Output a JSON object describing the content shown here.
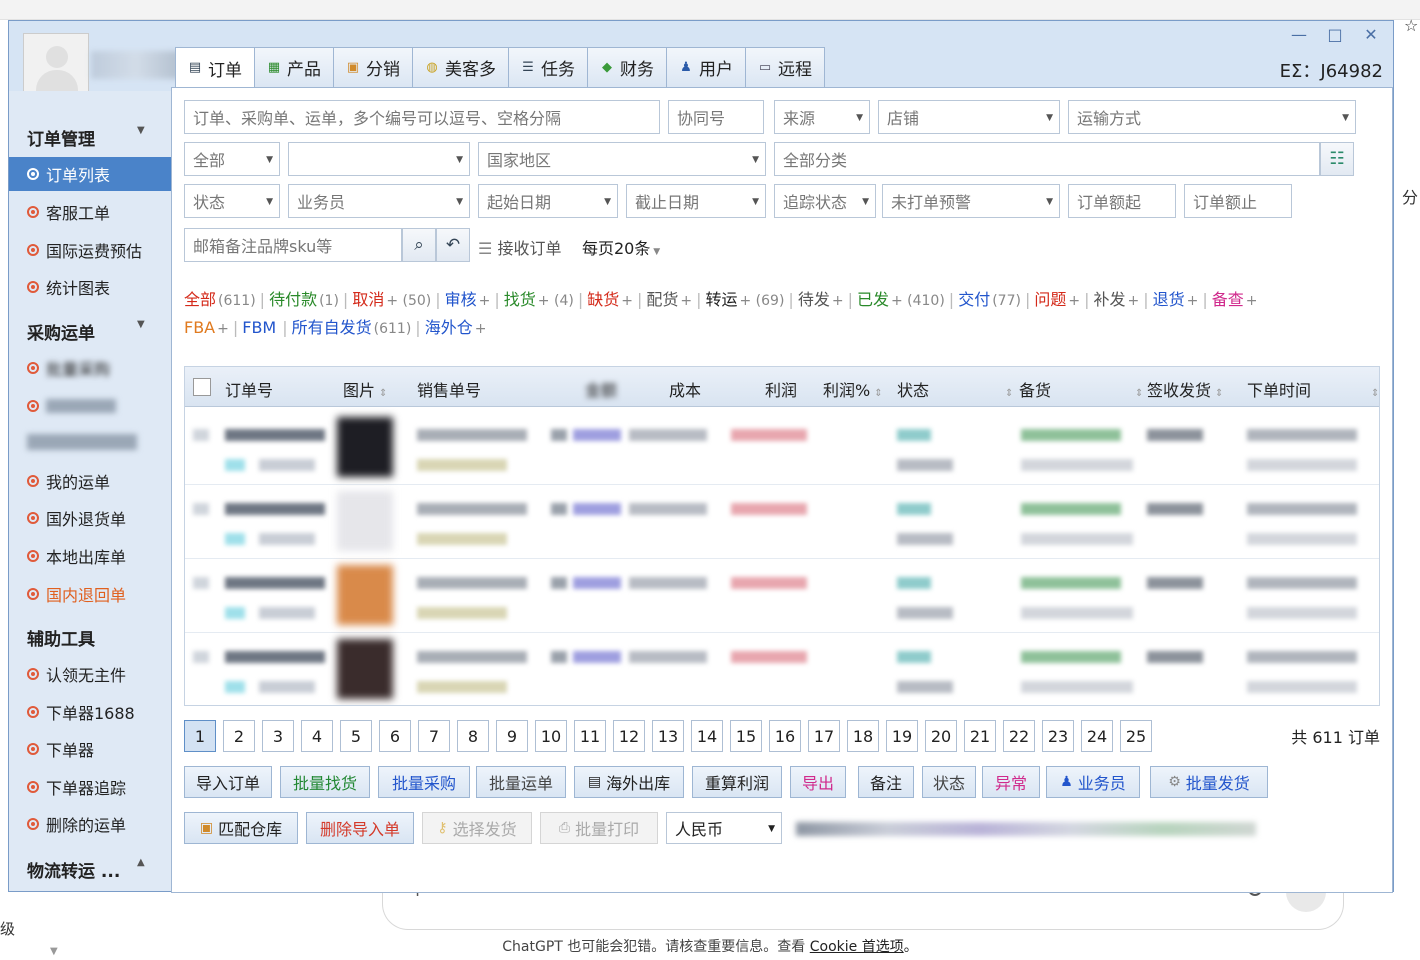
{
  "window": {
    "region_label": "EΣ—J64982",
    "tabs": [
      {
        "label": "订单",
        "icon": "document-icon"
      },
      {
        "label": "产品",
        "icon": "grid-icon"
      },
      {
        "label": "分销",
        "icon": "box-icon"
      },
      {
        "label": "美客多",
        "icon": "handshake-icon"
      },
      {
        "label": "任务",
        "icon": "list-icon"
      },
      {
        "label": "财务",
        "icon": "tag-icon"
      },
      {
        "label": "用户",
        "icon": "user-icon"
      },
      {
        "label": "远程",
        "icon": "monitor-icon"
      }
    ]
  },
  "sidebar": {
    "sections": [
      {
        "title": "订单管理",
        "items": [
          "订单列表",
          "客服工单",
          "国际运费预估",
          "统计图表"
        ]
      },
      {
        "title": "采购运单",
        "items": [
          "批量采购",
          "",
          "",
          "我的运单",
          "国外退货单",
          "本地出库单",
          "国内退回单"
        ]
      },
      {
        "title": "辅助工具",
        "items": [
          "认领无主件",
          "下单器1688",
          "下单器",
          "下单器追踪",
          "删除的运单"
        ]
      },
      {
        "title": "物流转运 ..."
      }
    ]
  },
  "filters": {
    "search_main": "订单、采购单、运单，多个编号可以逗号、空格分隔",
    "contract_no": "协同号",
    "source": "来源",
    "shop": "店铺",
    "shipping_method": "运输方式",
    "all": "全部",
    "blank_select": "",
    "country": "国家地区",
    "category": "全部分类",
    "status": "状态",
    "salesperson": "业务员",
    "start_date": "起始日期",
    "end_date": "截止日期",
    "tracking_status": "追踪状态",
    "unprinted_warning": "未打单预警",
    "amount_from": "订单额起",
    "amount_to": "订单额止",
    "keyword": "邮箱备注品牌sku等",
    "receive_label": "接收订单",
    "per_page": "每页20条"
  },
  "status_tabs": [
    {
      "label": "全部",
      "count": "(611)",
      "color": "#d42a1a"
    },
    {
      "label": "待付款",
      "count": "(1)",
      "color": "#2a8a2a"
    },
    {
      "label": "取消",
      "count": "+ (50)",
      "color": "#d42a1a"
    },
    {
      "label": "审核",
      "count": "+",
      "color": "#2255cc"
    },
    {
      "label": "找货",
      "count": "+ (4)",
      "color": "#2a8a2a"
    },
    {
      "label": "缺货",
      "count": "+",
      "color": "#d42a1a"
    },
    {
      "label": "配货",
      "count": "+",
      "color": "#555555"
    },
    {
      "label": "转运",
      "count": "+ (69)",
      "color": "#222222"
    },
    {
      "label": "待发",
      "count": "+",
      "color": "#555555"
    },
    {
      "label": "已发",
      "count": "+ (410)",
      "color": "#2a8a2a"
    },
    {
      "label": "交付",
      "count": "(77)",
      "color": "#2255cc"
    },
    {
      "label": "问题",
      "count": "+",
      "color": "#d42a1a"
    },
    {
      "label": "补发",
      "count": "+",
      "color": "#555555"
    },
    {
      "label": "退货",
      "count": "+",
      "color": "#2255cc"
    },
    {
      "label": "备查",
      "count": "+",
      "color": "#d02a8c"
    }
  ],
  "status_tabs_line2": [
    {
      "label": "FBA",
      "count": "+",
      "color": "#e07a1f"
    },
    {
      "label": "FBM",
      "count": "",
      "color": "#2255cc"
    },
    {
      "label": "所有自发货",
      "count": "(611)",
      "color": "#2255cc"
    },
    {
      "label": "海外仓",
      "count": "+",
      "color": "#2255cc"
    }
  ],
  "table": {
    "headers": [
      "订单号",
      "图片",
      "销售单号",
      "金额",
      "成本",
      "利润",
      "利润%",
      "状态",
      "备货",
      "签收发货",
      "下单时间"
    ]
  },
  "pager": {
    "pages": [
      "1",
      "2",
      "3",
      "4",
      "5",
      "6",
      "7",
      "8",
      "9",
      "10",
      "11",
      "12",
      "13",
      "14",
      "15",
      "16",
      "17",
      "18",
      "19",
      "20",
      "21",
      "22",
      "23",
      "24",
      "25"
    ],
    "current": "1",
    "total": "共 611 订单"
  },
  "actions_row1": [
    "导入订单",
    "批量找货",
    "批量采购",
    "批量运单",
    "海外出库",
    "重算利润",
    "导出",
    "备注",
    "状态",
    "异常",
    "业务员",
    "批量发货"
  ],
  "actions_row2": [
    "匹配仓库",
    "删除导入单",
    "选择发货",
    "批量打印"
  ],
  "currency": "人民币",
  "background": {
    "disclaimer": "ChatGPT 也可能会犯错。请核查重要信息。查看",
    "cookie_link": "Cookie 首选项",
    "disclaimer_end": "。",
    "right_char": "分",
    "left_char": "级"
  }
}
